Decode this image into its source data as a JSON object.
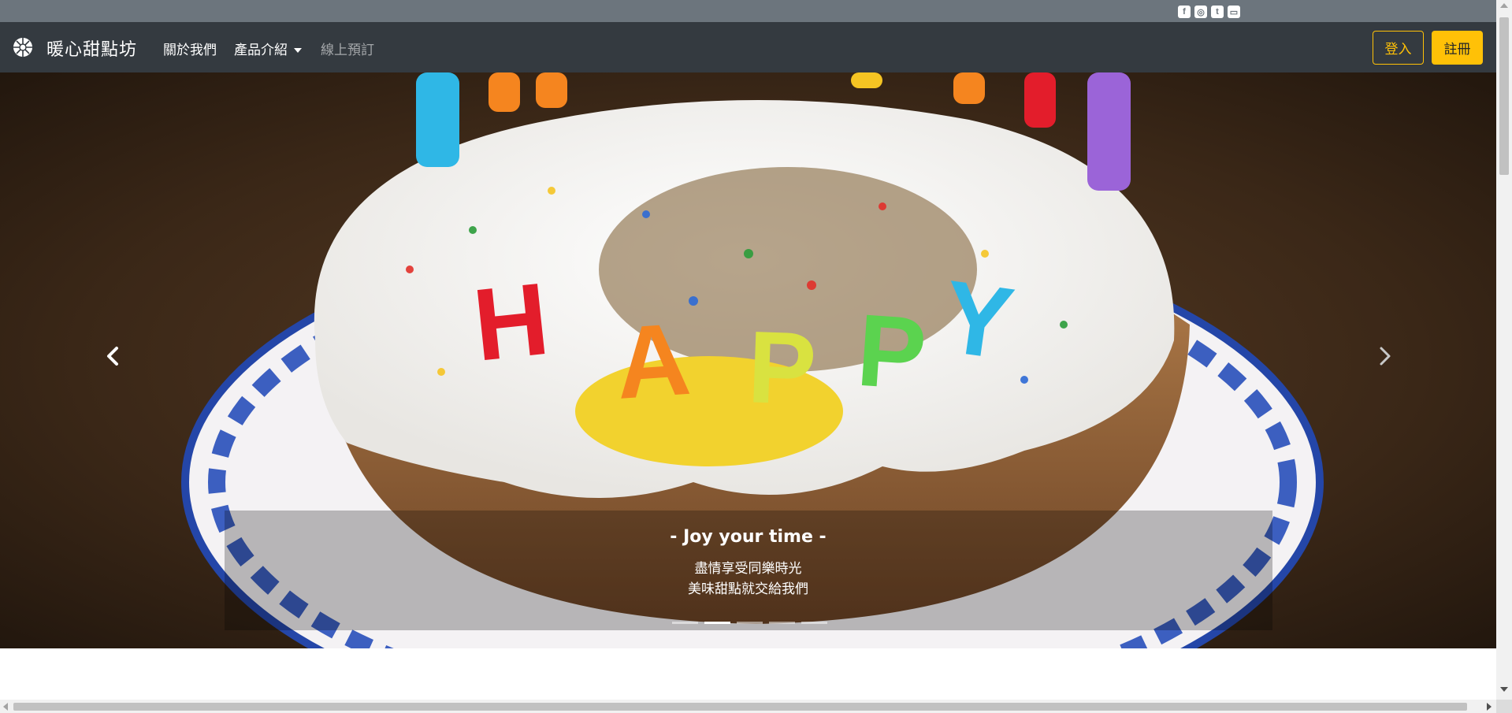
{
  "social": {
    "icons": [
      "facebook-icon",
      "instagram-icon",
      "twitter-icon",
      "line-icon"
    ],
    "glyphs": [
      "f",
      "◎",
      "t",
      "▭"
    ]
  },
  "navbar": {
    "brand": "暖心甜點坊",
    "links": {
      "about": "關於我們",
      "products": "產品介紹",
      "booking": "線上預訂"
    },
    "login": "登入",
    "register": "註冊"
  },
  "carousel": {
    "caption_title": "- Joy your time -",
    "caption_line1": "盡情享受同樂時光",
    "caption_line2": "美味甜點就交給我們",
    "slide_count": 5,
    "active_index": 1,
    "prev_icon": "chevron-left-icon",
    "next_icon": "chevron-right-icon"
  },
  "colors": {
    "navbar_bg": "#343a40",
    "topbar_bg": "#6c757d",
    "accent": "#ffc107"
  }
}
